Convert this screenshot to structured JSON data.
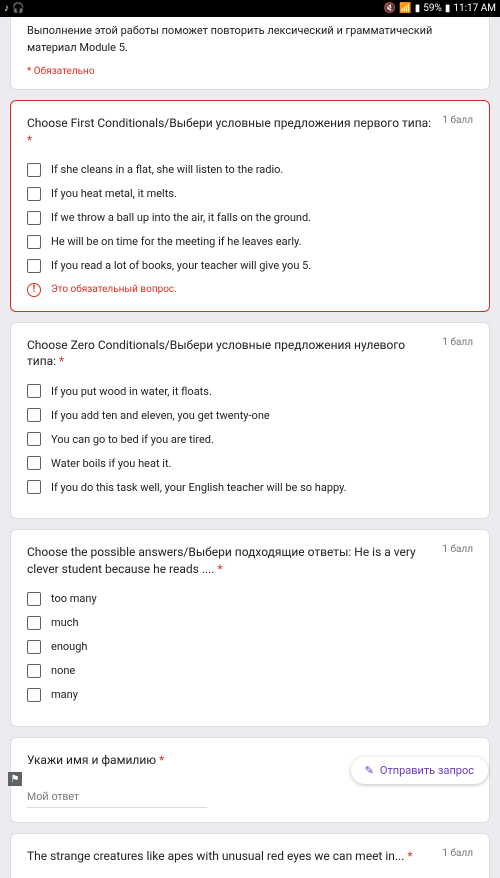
{
  "status": {
    "battery": "59%",
    "time": "11:17 AM"
  },
  "intro": {
    "text": "Выполнение этой работы поможет повторить лексический и грамматический материал Module 5.",
    "required": "* Обязательно"
  },
  "questions": [
    {
      "title": "Choose First Conditionals/Выбери условные предложения первого типа:",
      "points": "1 балл",
      "options": [
        "If she cleans in a flat, she will listen to the radio.",
        "If you heat metal, it melts.",
        "If we throw a ball up into the air, it falls on the ground.",
        "He will be on time for the meeting if he leaves early.",
        "If you read a lot of books, your teacher will give you 5."
      ],
      "error": "Это обязательный вопрос."
    },
    {
      "title": "Choose Zero Conditionals/Выбери условные предложения нулевого типа:",
      "points": "1 балл",
      "options": [
        "If you put wood in water, it floats.",
        "If you add ten and eleven, you get twenty-one",
        "You can go to bed if you are tired.",
        "Water boils if you heat it.",
        "If you do this task well, your English teacher will be so happy."
      ]
    },
    {
      "title": "Choose the possible answers/Выбери подходящие ответы: He is a very clever student because he reads ....",
      "points": "1 балл",
      "options": [
        "too many",
        "much",
        "enough",
        "none",
        "many"
      ]
    },
    {
      "title": "Укажи имя и фамилию",
      "placeholder": "Мой ответ"
    },
    {
      "title": "The strange creatures like apes with unusual red eyes we can meet in...",
      "points": "1 балл"
    }
  ],
  "fab": {
    "label": "Отправить запрос"
  },
  "asterisk": "*"
}
